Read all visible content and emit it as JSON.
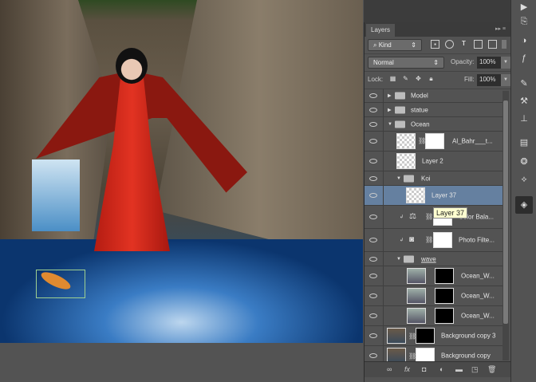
{
  "panel": {
    "tab": "Layers",
    "filter_kind": "Kind",
    "blend_mode": "Normal",
    "opacity_label": "Opacity:",
    "opacity": "100%",
    "lock_label": "Lock:",
    "fill_label": "Fill:",
    "fill": "100%"
  },
  "layers": [
    {
      "name": "Model",
      "type": "group",
      "expanded": false
    },
    {
      "name": "statue",
      "type": "group",
      "expanded": false
    },
    {
      "name": "Ocean",
      "type": "group",
      "expanded": true
    },
    {
      "name": "Al_Bahr___t...",
      "type": "layer"
    },
    {
      "name": "Layer 2",
      "type": "layer"
    },
    {
      "name": "Koi",
      "type": "group",
      "expanded": true
    },
    {
      "name": "Layer 37",
      "type": "layer",
      "selected": true
    },
    {
      "name": "Color Bala...",
      "type": "adjustment"
    },
    {
      "name": "Photo Filte...",
      "type": "adjustment"
    },
    {
      "name": "wave",
      "type": "group",
      "expanded": true
    },
    {
      "name": "Ocean_W...",
      "type": "smart"
    },
    {
      "name": "Ocean_W...",
      "type": "smart"
    },
    {
      "name": "Ocean_W...",
      "type": "smart"
    },
    {
      "name": "Background copy 3",
      "type": "layer"
    },
    {
      "name": "Background copy",
      "type": "layer"
    }
  ],
  "tooltip": "Layer 37",
  "colors": {
    "selection": "#6580a0",
    "panel": "#535353"
  }
}
